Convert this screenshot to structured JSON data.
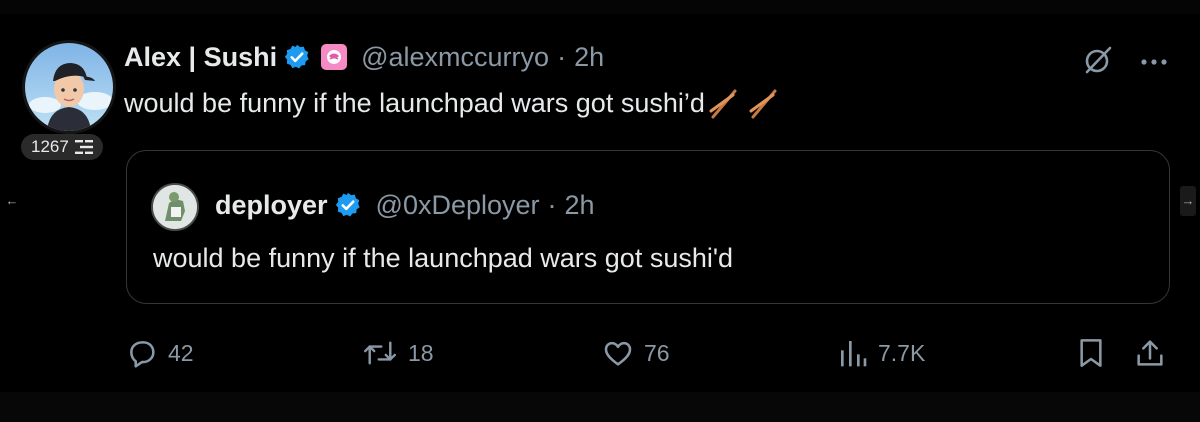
{
  "rank": {
    "value": "1267"
  },
  "author": {
    "name": "Alex | Sushi",
    "handle": "@alexmccurryo",
    "separator": "·",
    "time": "2h"
  },
  "tweet": {
    "text": "would be funny if the launchpad wars got sushi’d"
  },
  "quoted": {
    "name": "deployer",
    "handle": "@0xDeployer",
    "separator": "·",
    "time": "2h",
    "text": "would be funny if the launchpad wars got sushi'd"
  },
  "actions": {
    "replies": "42",
    "reposts": "18",
    "likes": "76",
    "views": "7.7K"
  },
  "nav": {
    "left_arrow": "←",
    "right_arrow": "→"
  },
  "colors": {
    "background": "#000000",
    "text_primary": "#e7e9ea",
    "text_secondary": "#8b98a5",
    "verified_blue": "#1d9bf0",
    "card_border": "#333639",
    "affiliate_pink": "#f58ac4"
  },
  "icons": [
    "verified-badge-icon",
    "affiliate-badge-icon",
    "grok-icon",
    "more-icon",
    "reply-icon",
    "repost-icon",
    "like-icon",
    "views-icon",
    "bookmark-icon",
    "share-icon",
    "chopsticks-icon",
    "leaderboard-icon"
  ]
}
